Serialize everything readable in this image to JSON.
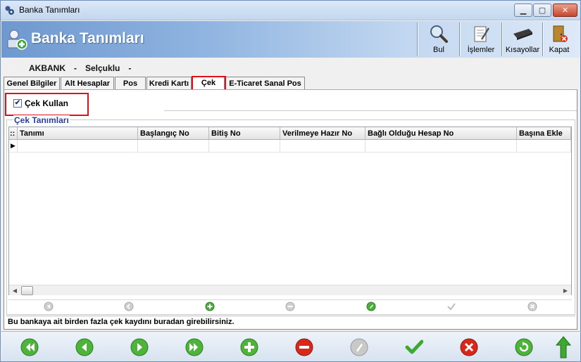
{
  "window": {
    "title": "Banka Tanımları"
  },
  "header": {
    "title": "Banka Tanımları"
  },
  "toolbar": {
    "bul": "Bul",
    "islemler": "İşlemler",
    "kisayollar": "Kısayollar",
    "kapat": "Kapat"
  },
  "bank": {
    "name": "AKBANK",
    "sep1": "-",
    "branch": "Selçuklu",
    "sep2": "-"
  },
  "tabs": [
    "Genel Bilgiler",
    "Alt Hesaplar",
    "Pos",
    "Kredi Kartı",
    "Çek",
    "E-Ticaret Sanal Pos"
  ],
  "active_tab": "Çek",
  "cek_kullan": {
    "label": "Çek Kullan",
    "checked": true
  },
  "group_title": "Çek Tanımları",
  "grid": {
    "corner": "::",
    "columns": [
      "Tanımı",
      "Başlangıç No",
      "Bitiş No",
      "Verilmeye Hazır No",
      "Bağlı Olduğu Hesap No",
      "Başına Ekle"
    ],
    "row_indicator": "▶"
  },
  "status_text": "Bu bankaya ait birden fazla çek kaydını buradan girebilirsiniz.",
  "colors": {
    "accent_red": "#e0101a",
    "header_blue": "#6e98cf",
    "group_title": "#2a3fa0"
  }
}
